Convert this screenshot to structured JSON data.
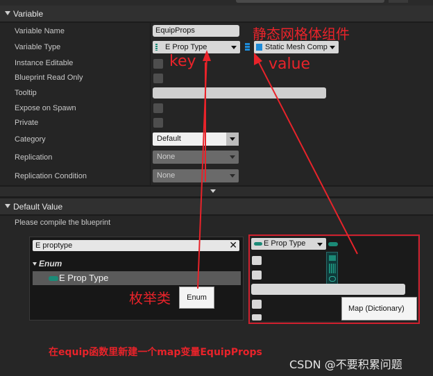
{
  "variable_section": {
    "title": "Variable"
  },
  "rows": {
    "variable_name": {
      "label": "Variable Name",
      "value": "EquipProps"
    },
    "variable_type": {
      "label": "Variable Type",
      "key_type": "E Prop Type",
      "value_type": "Static Mesh Comp"
    },
    "instance_editable": {
      "label": "Instance Editable"
    },
    "blueprint_read_only": {
      "label": "Blueprint Read Only"
    },
    "tooltip": {
      "label": "Tooltip"
    },
    "expose_on_spawn": {
      "label": "Expose on Spawn"
    },
    "private": {
      "label": "Private"
    },
    "category": {
      "label": "Category",
      "value": "Default"
    },
    "replication": {
      "label": "Replication",
      "value": "None"
    },
    "replication_condition": {
      "label": "Replication Condition",
      "value": "None"
    }
  },
  "default_section": {
    "title": "Default Value",
    "message": "Please compile the blueprint"
  },
  "type_picker": {
    "search_value": "E proptype",
    "close_glyph": "✕",
    "category": "Enum",
    "item": "E Prop Type",
    "tooltip": "Enum"
  },
  "container_picker": {
    "key_type": "E Prop Type",
    "tooltip": "Map (Dictionary)"
  },
  "annotations": {
    "static_mesh": "静态网格体组件",
    "key": "key",
    "value": "value",
    "enum": "枚举类",
    "bottom_note": "在equip函数里新建一个map变量EquipProps"
  },
  "watermark": "CSDN @不要积累问题",
  "colors": {
    "annotation_red": "#e8232a",
    "enum_teal": "#1b8a77",
    "object_blue": "#1e8bd8"
  }
}
